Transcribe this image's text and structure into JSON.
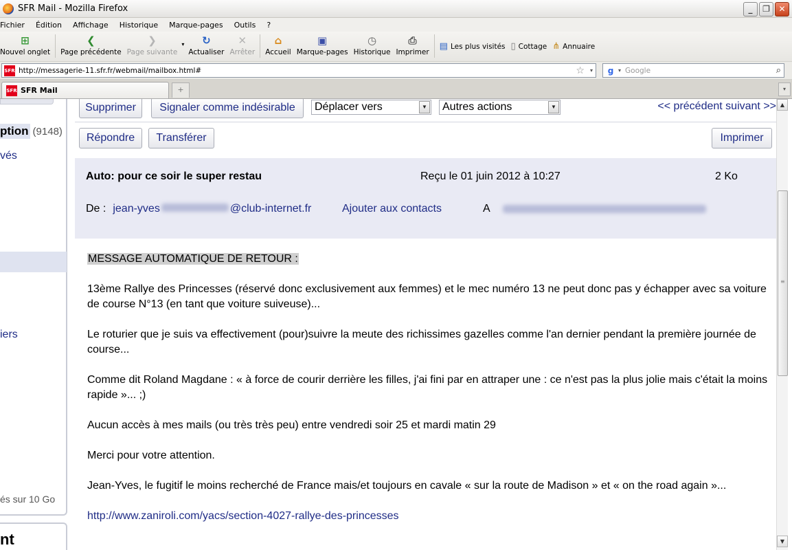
{
  "window": {
    "title": "SFR Mail - Mozilla Firefox",
    "minimize": "_",
    "maximize": "❐",
    "close": "✕"
  },
  "menu": {
    "items": [
      "Fichier",
      "Édition",
      "Affichage",
      "Historique",
      "Marque-pages",
      "Outils",
      "?"
    ]
  },
  "toolbar": {
    "new_tab": "Nouvel onglet",
    "back": "Page précédente",
    "forward": "Page suivante",
    "reload": "Actualiser",
    "stop": "Arrêter",
    "home": "Accueil",
    "bookmarks": "Marque-pages",
    "history": "Historique",
    "print": "Imprimer",
    "bm_most_visited": "Les plus visités",
    "bm_cottage": "Cottage",
    "bm_annuaire": "Annuaire"
  },
  "urlbar": {
    "favicon_text": "SFR",
    "url": "http://messagerie-11.sfr.fr/webmail/mailbox.html#",
    "search_placeholder": "Google"
  },
  "tabs": {
    "active_title": "SFR Mail",
    "favicon_text": "SFR",
    "new_tab_glyph": "+"
  },
  "sidebar": {
    "inbox_label": "ption",
    "inbox_count": "(9148)",
    "item_1": "vés",
    "item_2": "iers",
    "quota": "és sur 10 Go",
    "bottom_title": "nt"
  },
  "actions": {
    "delete": "Supprimer",
    "spam": "Signaler comme indésirable",
    "move_to": "Déplacer vers",
    "other_actions": "Autres actions",
    "prev": "<< précédent",
    "next": "suivant >>",
    "reply": "Répondre",
    "forward": "Transférer",
    "print": "Imprimer"
  },
  "message": {
    "subject": "Auto: pour ce soir le super restau",
    "received": "Reçu le 01 juin 2012 à 10:27",
    "size": "2 Ko",
    "from_label": "De :",
    "from_prefix": "jean-yves",
    "from_domain": "@club-internet.fr",
    "add_contact": "Ajouter aux contacts",
    "to_label": "A"
  },
  "body": {
    "title": "MESSAGE AUTOMATIQUE DE RETOUR :",
    "p1": "13ème Rallye des Princesses (réservé donc exclusivement aux femmes) et  le mec numéro 13 ne peut  donc pas y échapper avec sa voiture de course N°13 (en tant que voiture suiveuse)...",
    "p2": "Le roturier que je suis va effectivement (pour)suivre la meute des richissimes gazelles comme l'an dernier pendant la première journée de course...",
    "p3": "Comme dit Roland Magdane : « à force de courir derrière les filles, j'ai fini par en attraper une : ce n'est pas la plus jolie mais c'était la moins rapide »...  ;)",
    "p4": "Aucun accès à mes mails (ou très très peu) entre vendredi soir 25 et mardi matin 29",
    "p5": "Merci pour votre attention.",
    "p6": "Jean-Yves, le fugitif le moins recherché de France mais/et toujours en cavale « sur la route de Madison » et « on the road again »...",
    "link": "http://www.zaniroli.com/yacs/section-4027-rallye-des-princesses"
  }
}
